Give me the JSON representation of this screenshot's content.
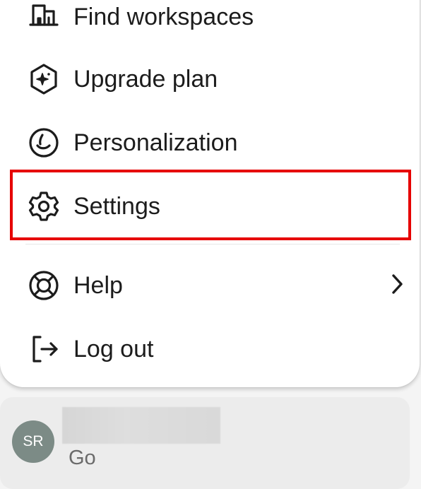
{
  "menu": {
    "items": [
      {
        "label": "Find workspaces",
        "icon": "building-icon"
      },
      {
        "label": "Upgrade plan",
        "icon": "sparkle-hexagon-icon"
      },
      {
        "label": "Personalization",
        "icon": "personalization-icon"
      },
      {
        "label": "Settings",
        "icon": "gear-icon"
      },
      {
        "label": "Help",
        "icon": "lifebuoy-icon"
      },
      {
        "label": "Log out",
        "icon": "logout-icon"
      }
    ],
    "help_submenu_icon": "chevron-right-icon"
  },
  "account": {
    "initials": "SR",
    "plan": "Go"
  },
  "colors": {
    "highlight": "#e60000",
    "avatar": "#7c8b86",
    "menu_background": "#ffffff",
    "page_background": "#f4f4f4"
  }
}
